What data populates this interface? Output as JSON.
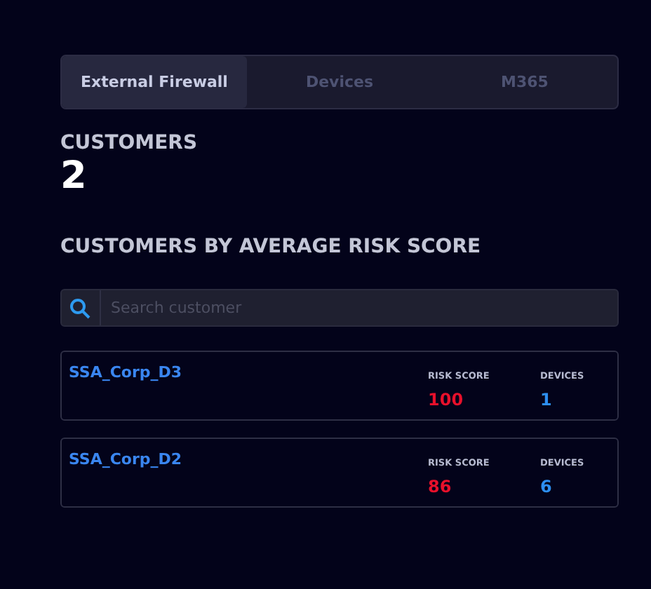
{
  "tabs": [
    {
      "label": "External Firewall",
      "selected": true
    },
    {
      "label": "Devices",
      "selected": false
    },
    {
      "label": "M365",
      "selected": false
    }
  ],
  "customers": {
    "label": "CUSTOMERS",
    "count": "2"
  },
  "section_title": "CUSTOMERS BY AVERAGE RISK SCORE",
  "search": {
    "placeholder": "Search customer"
  },
  "rows": [
    {
      "name": "SSA_Corp_D3",
      "risk_label": "RISK SCORE",
      "risk": "100",
      "devices_label": "DEVICES",
      "devices": "1"
    },
    {
      "name": "SSA_Corp_D2",
      "risk_label": "RISK SCORE",
      "risk": "86",
      "devices_label": "DEVICES",
      "devices": "6"
    }
  ]
}
